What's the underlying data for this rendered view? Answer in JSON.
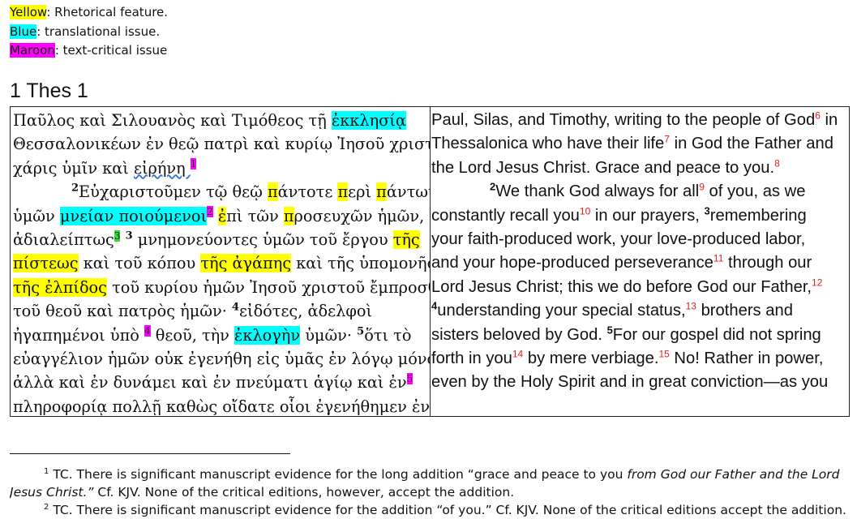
{
  "legend": [
    {
      "key": "Yellow",
      "text": ": Rhetorical feature.",
      "color": "#ffff00"
    },
    {
      "key": "Blue",
      "text": ": translational issue.",
      "color": "#00ffff"
    },
    {
      "key": "Maroon",
      "text": ": text-critical issue",
      "color": "#ff00ff"
    }
  ],
  "heading": "1 Thes 1",
  "greek": [
    [
      "Παῦλος καὶ Σιλουανὸς καὶ Τιμόθεος τῇ ",
      "ἐκκλησίᾳ",
      ""
    ],
    [
      "Θεσσαλονικέων ἐν θεῷ πατρὶ καὶ κυρίῳ Ἰησοῦ χριστῷ·"
    ],
    [
      "χάρις ὑμῖν καὶ ",
      "εἰρήνη ",
      "1"
    ],
    [
      "2",
      "Εὐχαριστοῦμεν τῷ θεῷ ",
      "π",
      "άντοτε ",
      "π",
      "ερὶ ",
      "π",
      "άντων"
    ],
    [
      "ὑμῶν ",
      "μνείαν ποιούμενοι",
      "2",
      " ",
      "ἐ",
      "πὶ τῶν ",
      "π",
      "ροσευχῶν ἡμῶν,"
    ],
    [
      "ἀδιαλείπτως",
      "3",
      " ",
      "3",
      " μνημονεύοντες ὑμῶν τοῦ ἔργου ",
      "τῆς"
    ],
    [
      "πίστεως",
      " καὶ τοῦ κόπου ",
      "τῆς ἀγάπης",
      " καὶ τῆς ὑπομονῆς"
    ],
    [
      "τῆς ἐλπίδος",
      " τοῦ κυρίου ἡμῶν Ἰησοῦ χριστοῦ ἔμπροσθεν"
    ],
    [
      "τοῦ θεοῦ καὶ πατρὸς ἡμῶν· ",
      "4",
      "εἰδότες, ἀδελφοὶ"
    ],
    [
      "ἠγαπημένοι ὑπὸ ",
      "4",
      " θεοῦ, τὴν ",
      "ἐκλογὴν",
      " ὑμῶν· ",
      "5",
      "ὅτι τὸ"
    ],
    [
      "εὐαγγέλιον ἡμῶν οὐκ ἐγενήθη εἰς ὑμᾶς ἐν λόγῳ μόνον"
    ],
    [
      "ἀλλὰ καὶ ἐν δυνάμει καὶ ἐν πνεύματι ἁγίῳ καὶ ἐν",
      "5"
    ],
    [
      "πληροφορίᾳ πολλῇ καθὼς οἴδατε οἷοι ἐγενήθημεν ἐν"
    ]
  ],
  "english": [
    [
      "Paul, Silas, and Timothy, writing to the people of God",
      "6",
      " in"
    ],
    [
      "Thessalonica who have their life",
      "7",
      " in God the Father and"
    ],
    [
      "the Lord Jesus Christ. Grace and peace to you.",
      "8"
    ],
    [
      "2",
      "We thank God always for all",
      "9",
      " of you, as we"
    ],
    [
      "constantly recall you",
      "10",
      " in our prayers, ",
      "3",
      "remembering"
    ],
    [
      "your faith-produced work, your love-produced labor,"
    ],
    [
      "and your hope-produced perseverance",
      "11",
      " through our"
    ],
    [
      "Lord Jesus Christ; this we do before God our Father,",
      "12"
    ],
    [
      "4",
      "understanding your special status,",
      "13",
      " brothers and"
    ],
    [
      "sisters beloved by God. ",
      "5",
      "For our gospel did not spring"
    ],
    [
      "forth in you",
      "14",
      " by mere verbiage.",
      "15",
      " No! Rather in power,"
    ],
    [
      "even by the Holy Spirit and in great conviction—as you"
    ]
  ],
  "footnotes": [
    {
      "num": "1",
      "lines": [
        "TC. There is significant manuscript evidence for the long addition “grace and peace to you ",
        "from God our Father and the Lord",
        "Jesus Christ.”",
        " Cf. KJV. None of the critical editions, however, accept the addition."
      ]
    },
    {
      "num": "2",
      "lines": [
        "TC. There is significant manuscript evidence for the addition “of you.” Cf. KJV. None of the critical editions accept the addition."
      ]
    }
  ]
}
